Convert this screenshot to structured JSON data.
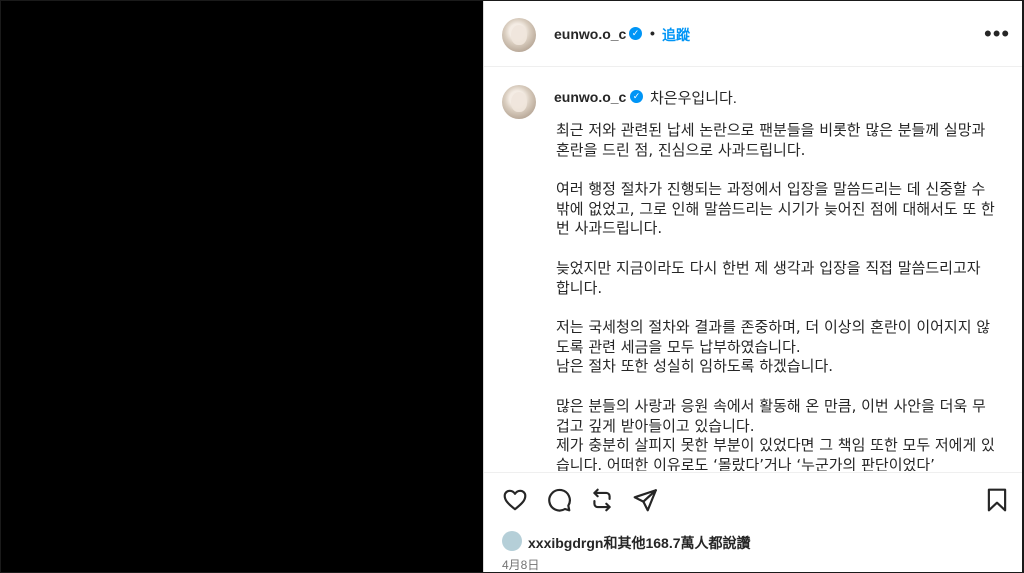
{
  "post": {
    "username": "eunwo.o_c",
    "follow_label": "追蹤",
    "separator": "•",
    "more_label": "•••",
    "verified_mark": "✓"
  },
  "caption": {
    "first_line": "차은우입니다.",
    "paragraphs": [
      "최근 저와 관련된 납세 논란으로 팬분들을 비롯한 많은 분들께 실망과 혼란을 드린 점, 진심으로 사과드립니다.",
      "여러 행정 절차가 진행되는 과정에서 입장을 말씀드리는 데 신중할 수밖에 없었고, 그로 인해 말씀드리는 시기가 늦어진 점에 대해서도 또 한 번 사과드립니다.",
      "늦었지만 지금이라도 다시 한번 제 생각과 입장을 직접 말씀드리고자 합니다.",
      "저는 국세청의 절차와 결과를 존중하며, 더 이상의 혼란이 이어지지 않도록 관련 세금을 모두 납부하였습니다.\n남은 절차 또한 성실히 임하도록 하겠습니다.",
      "많은 분들의 사랑과 응원 속에서 활동해 온 만큼, 이번 사안을 더욱 무겁고 깊게 받아들이고 있습니다.\n제가 충분히 살피지 못한 부분이 있었다면 그 책임 또한 모두 저에게 있습니다. 어떠한 이유로도 ‘몰랐다’거나 ‘누군가의 판단이었다’"
    ]
  },
  "actions": {
    "like_icon": "heart-icon",
    "comment_icon": "comment-icon",
    "repost_icon": "repost-icon",
    "share_icon": "send-icon",
    "save_icon": "bookmark-icon"
  },
  "likes": {
    "text": "xxxibgdrgn和其他168.7萬人都說讚"
  },
  "date": "4月8日",
  "colors": {
    "accent": "#0095f6",
    "text": "#262626",
    "muted": "#737373"
  }
}
